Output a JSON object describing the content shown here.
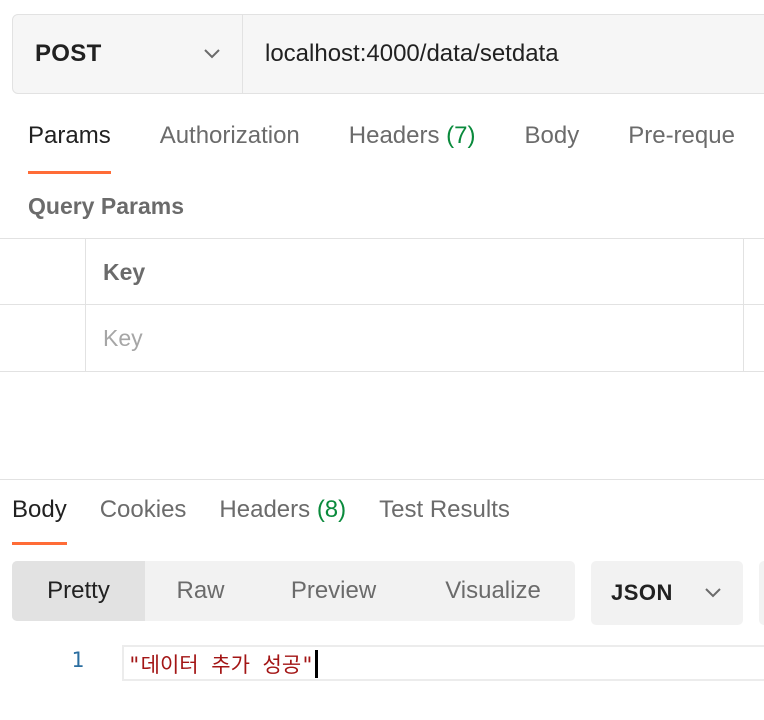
{
  "request": {
    "method": "POST",
    "url": "localhost:4000/data/setdata"
  },
  "request_tabs": [
    {
      "label": "Params",
      "active": true
    },
    {
      "label": "Authorization"
    },
    {
      "label": "Headers",
      "count": "(7)"
    },
    {
      "label": "Body"
    },
    {
      "label": "Pre-reque"
    }
  ],
  "query_params": {
    "title": "Query Params",
    "key_header": "Key",
    "key_placeholder": "Key"
  },
  "response_tabs": [
    {
      "label": "Body",
      "active": true
    },
    {
      "label": "Cookies"
    },
    {
      "label": "Headers",
      "count": "(8)"
    },
    {
      "label": "Test Results"
    }
  ],
  "view_modes": [
    "Pretty",
    "Raw",
    "Preview",
    "Visualize"
  ],
  "active_view": "Pretty",
  "format": "JSON",
  "response_body": {
    "line_number": "1",
    "content": "\"데이터 추가 성공\""
  },
  "colors": {
    "accent": "#ff6c37",
    "count_green": "#0a8a3c",
    "string_red": "#a31515",
    "line_number_blue": "#2b6ea0"
  }
}
